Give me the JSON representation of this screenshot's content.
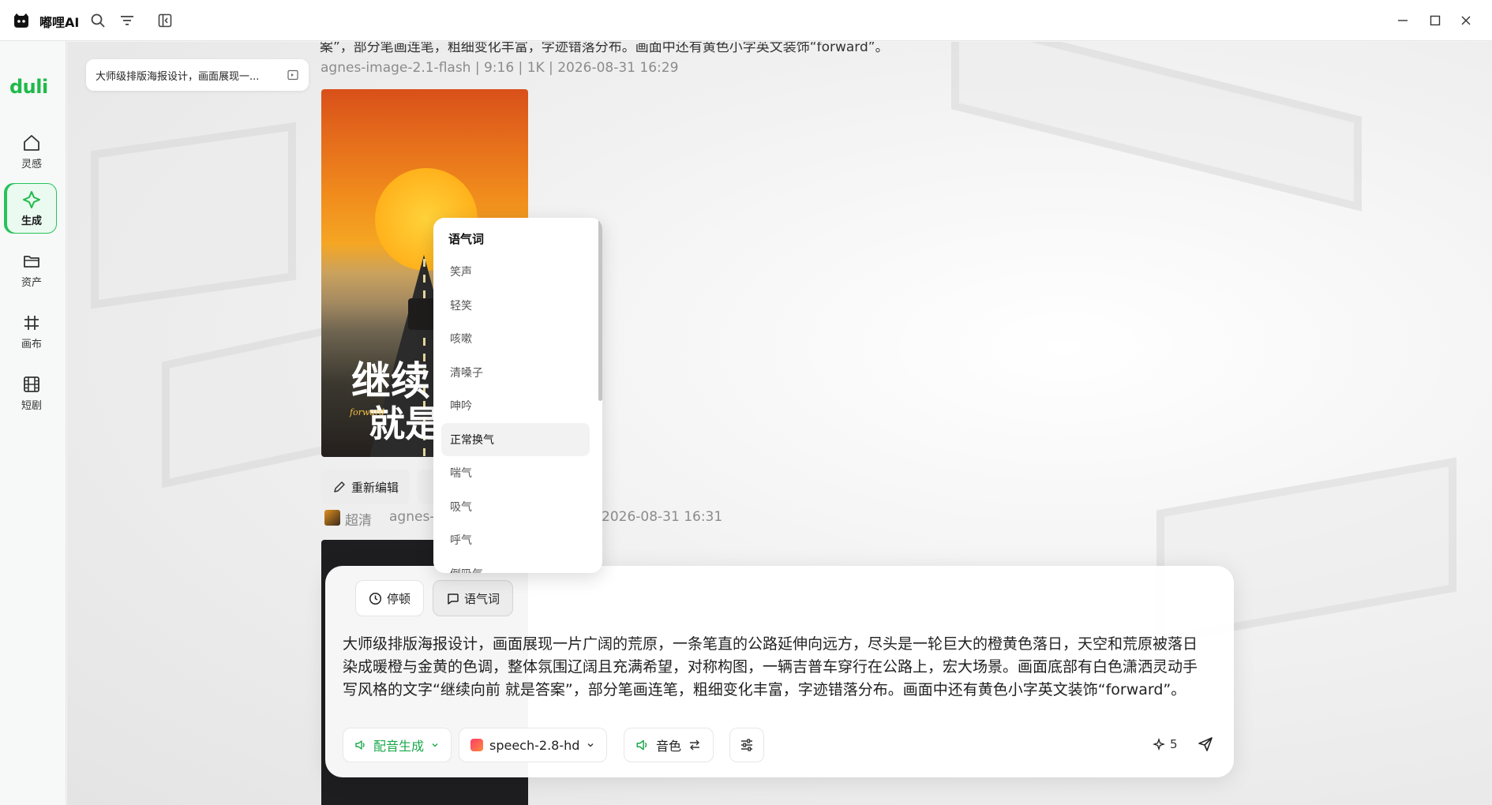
{
  "app": {
    "title": "嘟哩AI",
    "brand": "duli"
  },
  "sidebar": {
    "items": [
      {
        "label": "灵感",
        "icon": "home-icon",
        "active": false
      },
      {
        "label": "生成",
        "icon": "sparkle-icon",
        "active": true
      },
      {
        "label": "资产",
        "icon": "folder-icon",
        "active": false
      },
      {
        "label": "画布",
        "icon": "canvas-grid-icon",
        "active": false
      },
      {
        "label": "短剧",
        "icon": "film-icon",
        "active": false
      }
    ]
  },
  "history": {
    "chip_text": "大师级排版海报设计，画面展现一..."
  },
  "feed": {
    "previous_prompt_tail": "案”，部分笔画连笔，粗细变化丰富，字迹错落分布。画面中还有黄色小字英文装饰“forward”。",
    "item1": {
      "meta": "agnes-image-2.1-flash | 9:16 | 1K | 2026-08-31 16:29",
      "poster_title_line1": "继续向",
      "poster_title_line2": "就是",
      "poster_small": "forward",
      "actions": {
        "reedit": "重新编辑"
      }
    },
    "item2": {
      "quality": "超清",
      "model": "agnes-i",
      "timestamp": "2026-08-31 16:31"
    }
  },
  "dropdown": {
    "header": "语气词",
    "items": [
      "笑声",
      "轻笑",
      "咳嗽",
      "清嗓子",
      "呻吟",
      "正常换气",
      "喘气",
      "吸气",
      "呼气",
      "倒吸气"
    ],
    "hovered_item": "正常换气"
  },
  "composer": {
    "tabs": [
      {
        "label": "停顿",
        "icon": "clock-icon"
      },
      {
        "label": "语气词",
        "icon": "chat-bubble-icon"
      }
    ],
    "prompt": "大师级排版海报设计，画面展现一片广阔的荒原，一条笔直的公路延伸向远方，尽头是一轮巨大的橙黄色落日，天空和荒原被落日染成暖橙与金黄的色调，整体氛围辽阔且充满希望，对称构图，一辆吉普车穿行在公路上，宏大场景。画面底部有白色潇洒灵动手写风格的文字“继续向前 就是答案”，部分笔画连笔，粗细变化丰富，字迹错落分布。画面中还有黄色小字英文装饰“forward”。",
    "mode_label": "配音生成",
    "model_label": "speech-2.8-hd",
    "voice_label": "音色",
    "credits": "5"
  },
  "colors": {
    "accent": "#1fba4a"
  }
}
